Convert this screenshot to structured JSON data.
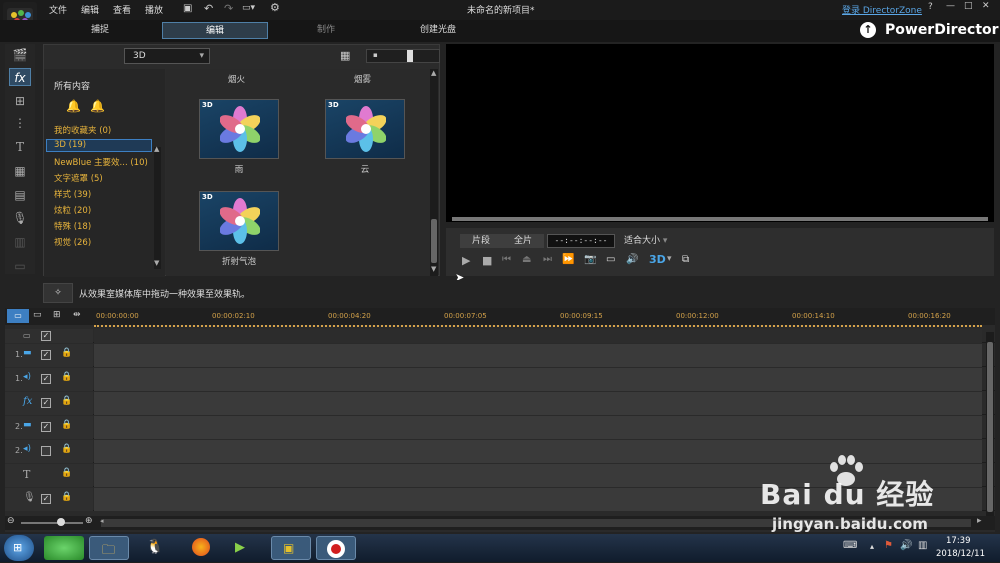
{
  "app": {
    "title": "未命名的新项目*",
    "login": "登录 DirectorZone",
    "brand": "PowerDirector"
  },
  "menu": [
    "文件",
    "编辑",
    "查看",
    "播放"
  ],
  "modes": [
    "捕捉",
    "编辑",
    "制作",
    "创建光盘"
  ],
  "library": {
    "filter_value": "3D",
    "categories_title": "所有内容",
    "categories": [
      "我的收藏夹 (0)",
      "3D (19)",
      "NewBlue 主要效... (10)",
      "文字遮罩 (5)",
      "样式 (39)",
      "炫粒 (20)",
      "特殊 (18)",
      "视觉 (26)"
    ],
    "top_labels": [
      "烟火",
      "烟雾"
    ],
    "effects": [
      {
        "name": "雨",
        "badge": "3D"
      },
      {
        "name": "云",
        "badge": "3D"
      },
      {
        "name": "折射气泡",
        "badge": "3D"
      }
    ]
  },
  "player": {
    "clip_btn": "片段",
    "full_btn": "全片",
    "timecode": "--:--:--:--",
    "fit_select": "适合大小",
    "three_d": "3D"
  },
  "hint": "从效果室媒体库中拖动一种效果至效果轨。",
  "timeline": {
    "ticks": [
      "00:00:00:00",
      "00:00:02:10",
      "00:00:04:20",
      "00:00:07:05",
      "00:00:09:15",
      "00:00:12:00",
      "00:00:14:10",
      "00:00:16:20"
    ],
    "tracks": [
      {
        "label": "",
        "checked": true
      },
      {
        "label": "1.",
        "checked": true
      },
      {
        "label": "1.",
        "checked": true
      },
      {
        "label": "fx",
        "checked": true
      },
      {
        "label": "2.",
        "checked": true
      },
      {
        "label": "2.",
        "checked": false
      },
      {
        "label": "T",
        "checked": null
      },
      {
        "label": "",
        "checked": true
      },
      {
        "label": "",
        "checked": true
      }
    ]
  },
  "taskbar": {
    "time": "17:39",
    "date": "2018/12/11"
  },
  "watermark": {
    "brand": "Bai du 经验",
    "url": "jingyan.baidu.com"
  },
  "colors": {
    "accent": "#e8b43c",
    "select": "#3d7fc2",
    "brandtext": "#ffffff"
  }
}
